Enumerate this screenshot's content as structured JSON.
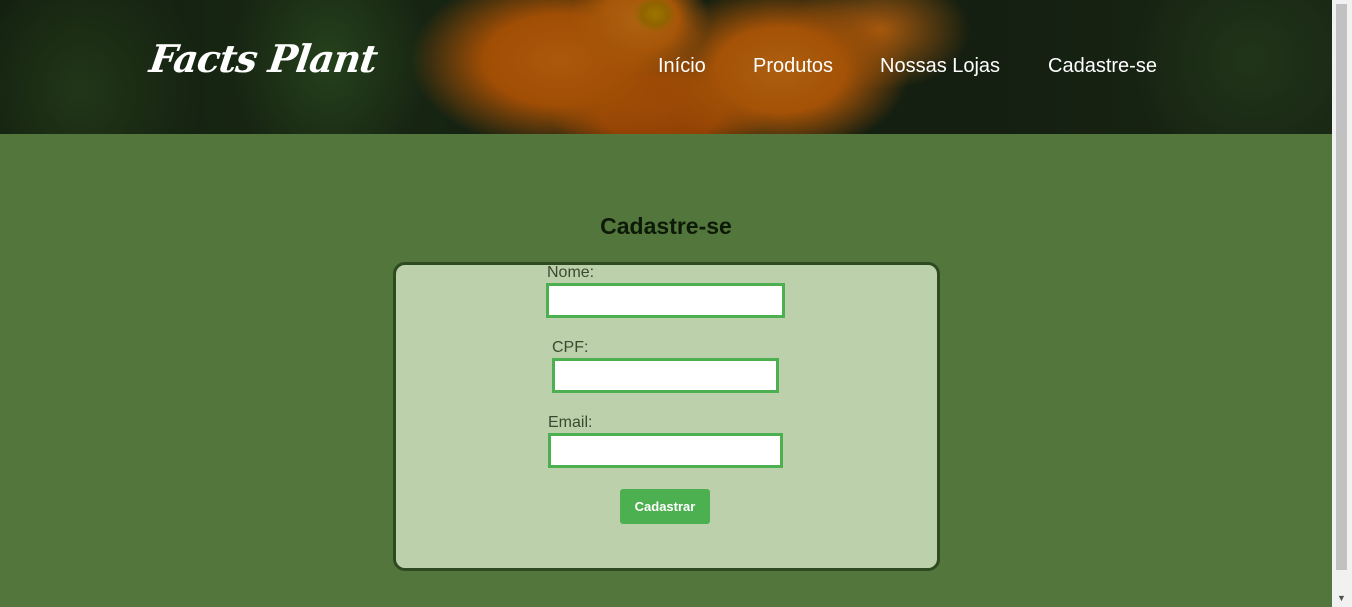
{
  "header": {
    "logo": "Facts Plant",
    "nav": [
      {
        "label": "Início"
      },
      {
        "label": "Produtos"
      },
      {
        "label": "Nossas Lojas"
      },
      {
        "label": "Cadastre-se"
      }
    ]
  },
  "form": {
    "title": "Cadastre-se",
    "fields": [
      {
        "label": "Nome:",
        "value": ""
      },
      {
        "label": "CPF:",
        "value": ""
      },
      {
        "label": "Email:",
        "value": ""
      }
    ],
    "submit_label": "Cadastrar"
  },
  "colors": {
    "page_background": "#52763b",
    "card_background": "#bcd1ab",
    "accent_green": "#4caf50",
    "card_border": "#2e4a20"
  }
}
